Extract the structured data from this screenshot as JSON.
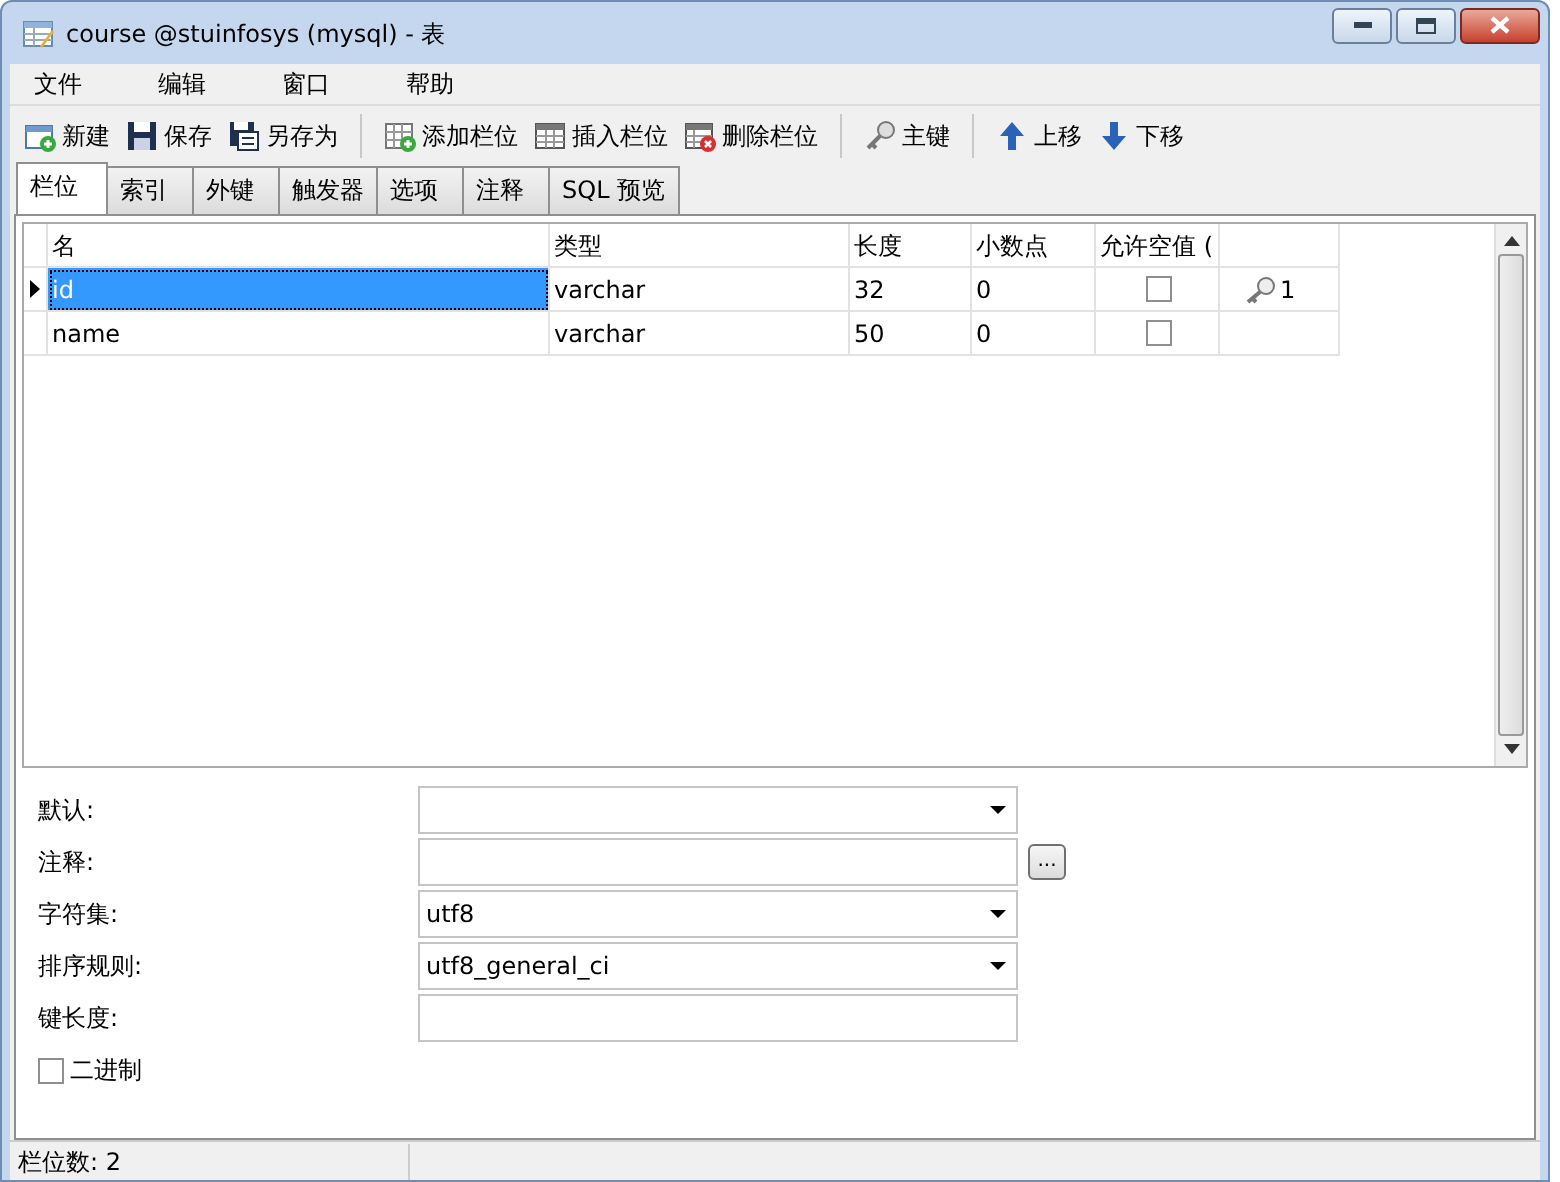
{
  "window": {
    "title": "course @stuinfosys (mysql) - 表"
  },
  "menu": [
    "文件",
    "编辑",
    "窗口",
    "帮助"
  ],
  "toolbar": [
    [
      "新建",
      "保存",
      "另存为"
    ],
    [
      "添加栏位",
      "插入栏位",
      "删除栏位"
    ],
    [
      "主键"
    ],
    [
      "上移",
      "下移"
    ]
  ],
  "tabs": [
    {
      "label": "栏位",
      "selected": true
    },
    {
      "label": "索引",
      "selected": false
    },
    {
      "label": "外键",
      "selected": false
    },
    {
      "label": "触发器",
      "selected": false
    },
    {
      "label": "选项",
      "selected": false
    },
    {
      "label": "注释",
      "selected": false
    },
    {
      "label": "SQL 预览",
      "selected": false
    }
  ],
  "grid": {
    "columns": [
      "名",
      "类型",
      "长度",
      "小数点",
      "允许空值 ("
    ],
    "rows": [
      {
        "name": "id",
        "type": "varchar",
        "length": "32",
        "decimals": "0",
        "allow_null": false,
        "primary_key": true,
        "key_order": "1",
        "selected": true
      },
      {
        "name": "name",
        "type": "varchar",
        "length": "50",
        "decimals": "0",
        "allow_null": false,
        "primary_key": false,
        "selected": false
      }
    ]
  },
  "properties": [
    {
      "kind": "dropdown",
      "label": "默认:"
    },
    {
      "kind": "text_button",
      "label": "注释:",
      "button": "..."
    },
    {
      "kind": "dropdown",
      "label": "字符集:",
      "value": "utf8"
    },
    {
      "kind": "dropdown",
      "label": "排序规则:",
      "value": "utf8_general_ci"
    },
    {
      "kind": "text",
      "label": "键长度:"
    },
    {
      "kind": "checkbox",
      "label": "二进制",
      "checked": false
    }
  ],
  "status_bar": [
    "栏位数: 2"
  ]
}
